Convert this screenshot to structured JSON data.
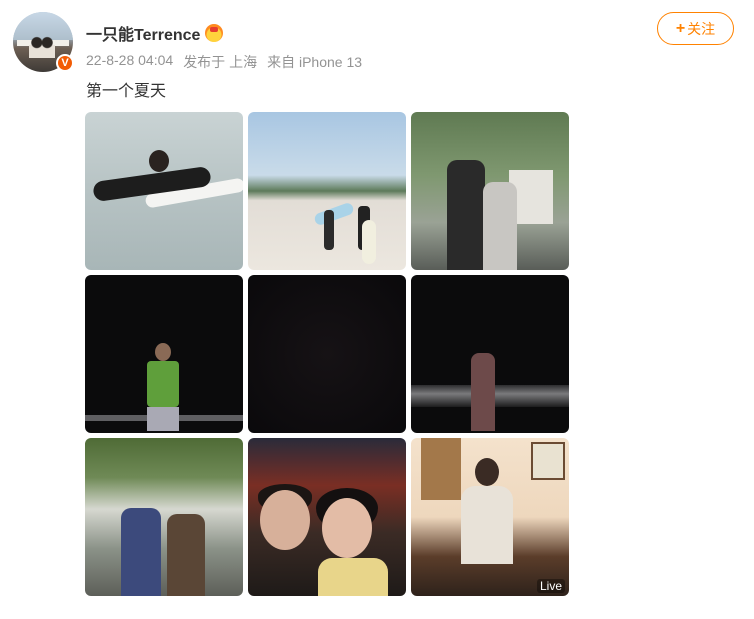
{
  "post": {
    "author": {
      "name": "一只能Terrence",
      "verified_icon": "verified-v-icon",
      "badge_icon": "crown-emoji-icon"
    },
    "meta": {
      "timestamp": "22-8-28 04:04",
      "location": "发布于 上海",
      "device": "来自 iPhone 13"
    },
    "follow_button": {
      "icon": "plus-icon",
      "icon_text": "+",
      "label": "关注"
    },
    "text": "第一个夏天",
    "photos": [
      {
        "alt": "surfing-photo"
      },
      {
        "alt": "beach-photo"
      },
      {
        "alt": "couple-outdoor-photo"
      },
      {
        "alt": "night-beach-man-photo"
      },
      {
        "alt": "night-sky-photo"
      },
      {
        "alt": "night-beach-woman-photo"
      },
      {
        "alt": "couple-under-tree-photo"
      },
      {
        "alt": "selfie-photo"
      },
      {
        "alt": "tea-room-photo",
        "badge": "Live"
      }
    ]
  },
  "colors": {
    "accent": "#ff8200",
    "verified": "#f25c05",
    "text": "#333333",
    "meta_text": "#939393"
  }
}
